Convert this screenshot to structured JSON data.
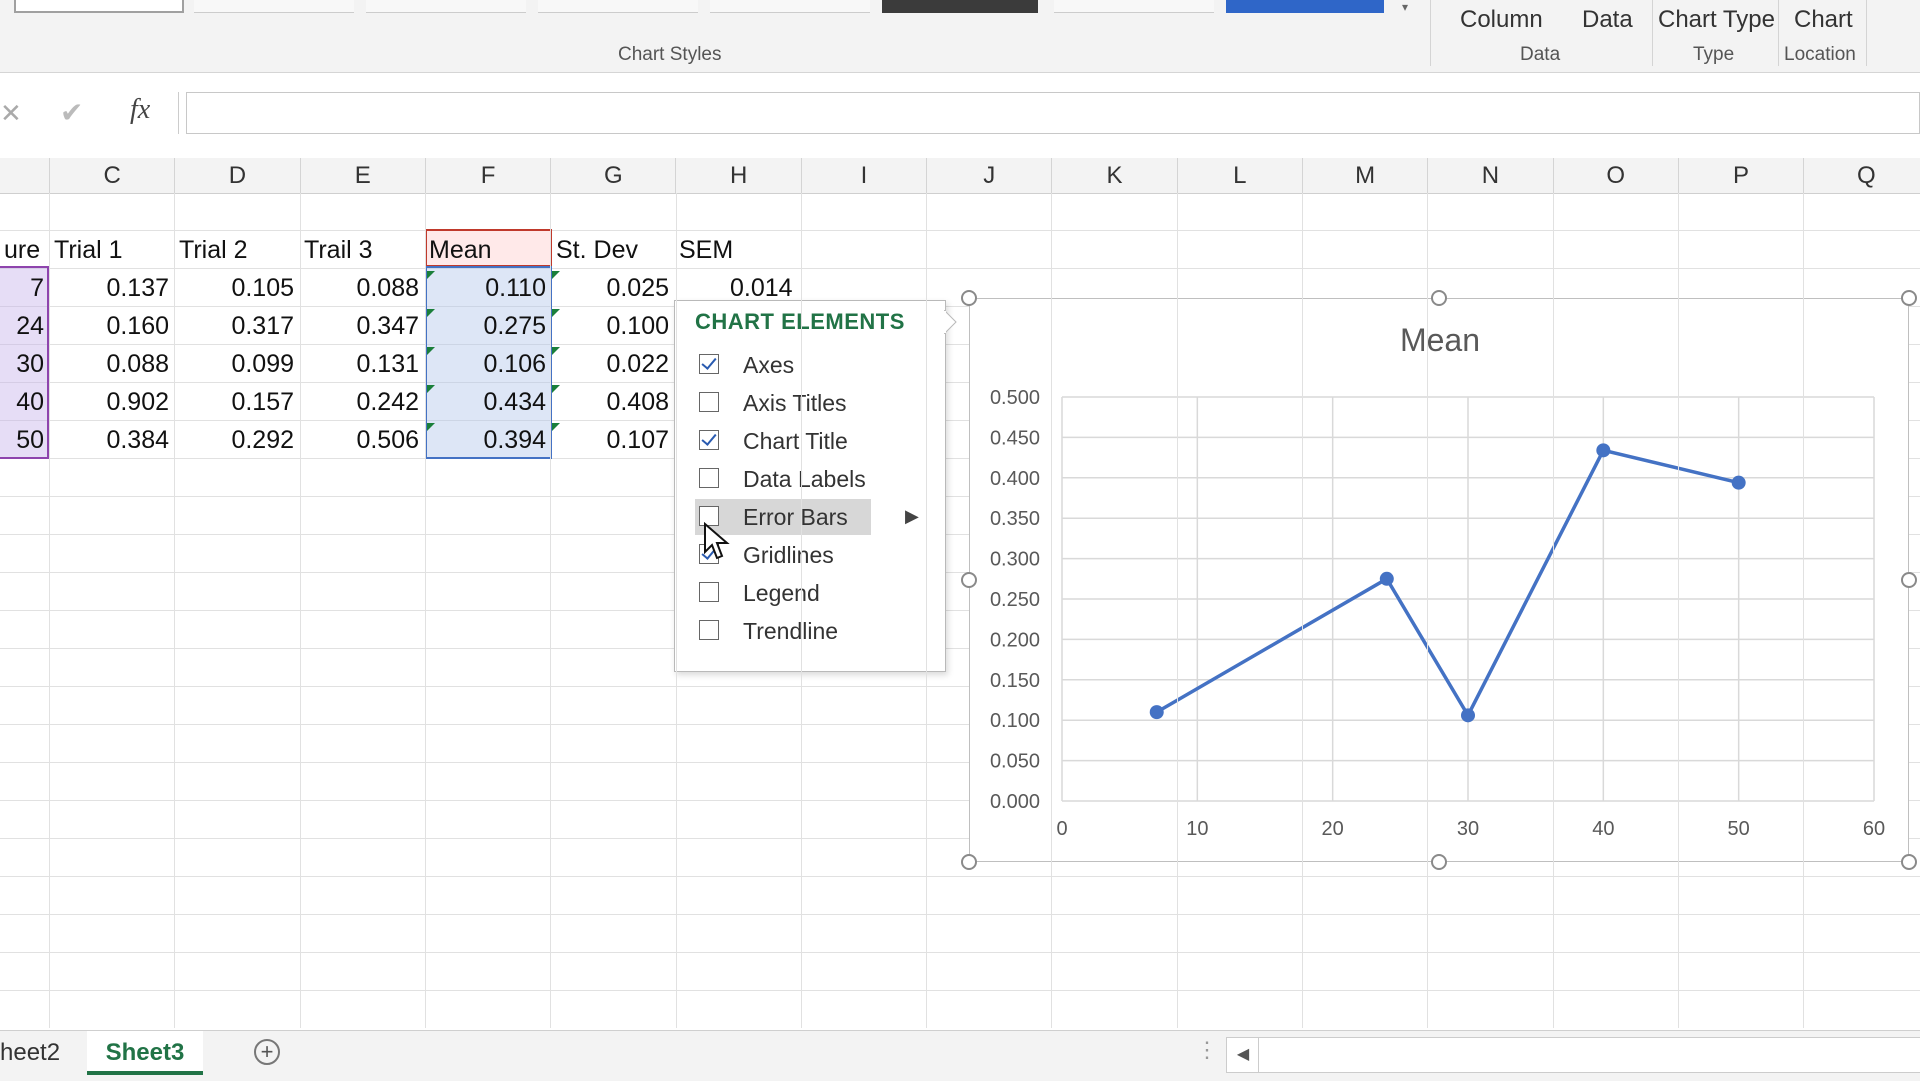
{
  "ribbon": {
    "groups": {
      "chart_styles": "Chart Styles",
      "data": "Data",
      "type": "Type",
      "location": "Location"
    },
    "buttons": {
      "switch_row_column": "Column",
      "select_data": "Data",
      "change_chart_type": "Chart Type",
      "move_chart": "Chart"
    }
  },
  "formula_bar": {
    "fx_label": "fx",
    "value": ""
  },
  "columns": [
    "C",
    "D",
    "E",
    "F",
    "G",
    "H",
    "I",
    "J",
    "K",
    "L",
    "M",
    "N",
    "O",
    "P",
    "Q"
  ],
  "table": {
    "headers": {
      "b": "ure",
      "c": "Trial 1",
      "d": "Trial 2",
      "e": "Trail 3",
      "f": "Mean",
      "g": "St. Dev",
      "h": "SEM"
    },
    "rows": [
      {
        "b": "7",
        "c": "0.137",
        "d": "0.105",
        "e": "0.088",
        "f": "0.110",
        "g": "0.025",
        "h": "0.014"
      },
      {
        "b": "24",
        "c": "0.160",
        "d": "0.317",
        "e": "0.347",
        "f": "0.275",
        "g": "0.100",
        "h": ""
      },
      {
        "b": "30",
        "c": "0.088",
        "d": "0.099",
        "e": "0.131",
        "f": "0.106",
        "g": "0.022",
        "h": ""
      },
      {
        "b": "40",
        "c": "0.902",
        "d": "0.157",
        "e": "0.242",
        "f": "0.434",
        "g": "0.408",
        "h": ""
      },
      {
        "b": "50",
        "c": "0.384",
        "d": "0.292",
        "e": "0.506",
        "f": "0.394",
        "g": "0.107",
        "h": ""
      }
    ]
  },
  "chart_elements_popup": {
    "title": "CHART ELEMENTS",
    "items": [
      {
        "label": "Axes",
        "checked": true
      },
      {
        "label": "Axis Titles",
        "checked": false
      },
      {
        "label": "Chart Title",
        "checked": true
      },
      {
        "label": "Data Labels",
        "checked": false
      },
      {
        "label": "Error Bars",
        "checked": false,
        "hovered": true,
        "has_submenu": true
      },
      {
        "label": "Gridlines",
        "checked": true
      },
      {
        "label": "Legend",
        "checked": false
      },
      {
        "label": "Trendline",
        "checked": false
      }
    ]
  },
  "chart_data": {
    "type": "scatter",
    "title": "Mean",
    "x": [
      7,
      24,
      30,
      40,
      50
    ],
    "y": [
      0.11,
      0.275,
      0.106,
      0.434,
      0.394
    ],
    "xlim": [
      0,
      60
    ],
    "ylim": [
      0,
      0.5
    ],
    "xticks": [
      "0",
      "10",
      "20",
      "30",
      "40",
      "50",
      "60"
    ],
    "yticks": [
      "0.000",
      "0.050",
      "0.100",
      "0.150",
      "0.200",
      "0.250",
      "0.300",
      "0.350",
      "0.400",
      "0.450",
      "0.500"
    ],
    "grid": true,
    "line_color": "#4472c4"
  },
  "sheet_tabs": {
    "tabs": [
      "heet2",
      "Sheet3"
    ],
    "active": "Sheet3",
    "accent": "#217346"
  }
}
